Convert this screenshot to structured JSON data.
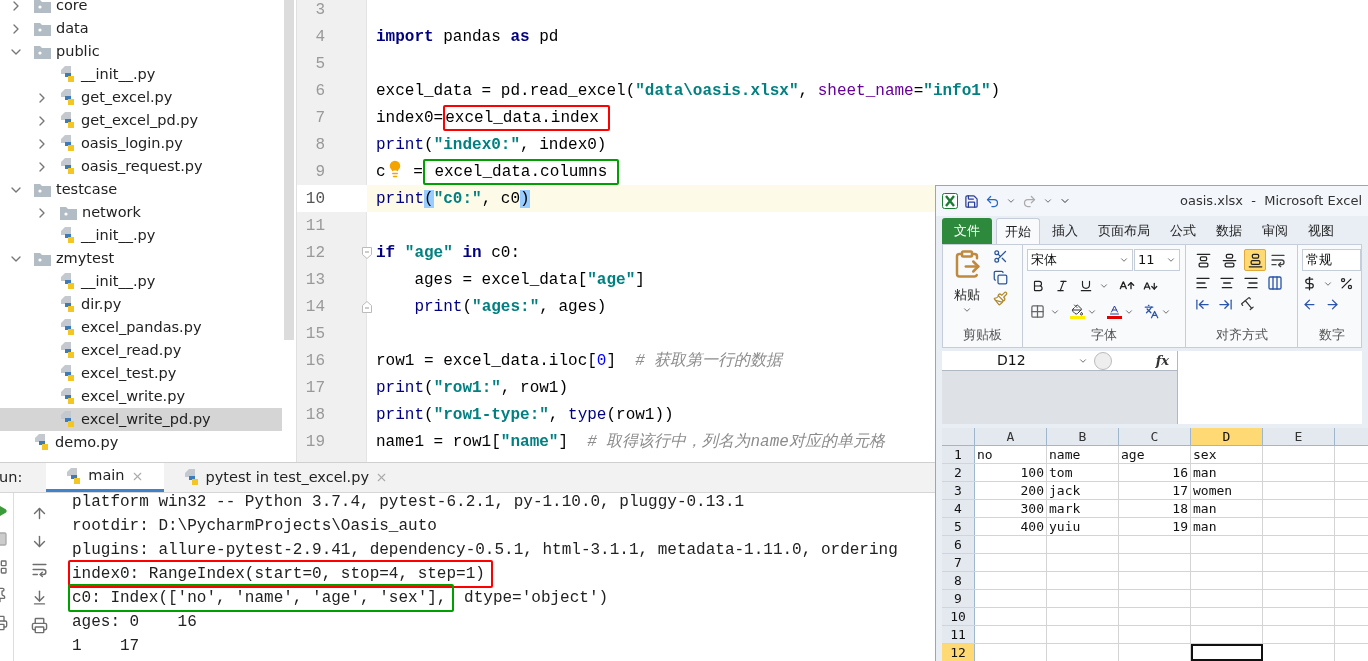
{
  "project_tree": {
    "items": [
      {
        "label": "core",
        "kind": "folder",
        "expanded": false,
        "selected": false
      },
      {
        "label": "data",
        "kind": "folder",
        "expanded": false,
        "selected": false
      },
      {
        "label": "public",
        "kind": "folder",
        "expanded": true,
        "selected": false,
        "children": [
          {
            "label": "__init__.py",
            "kind": "file",
            "selected": false
          },
          {
            "label": "get_excel.py",
            "kind": "file",
            "expanded": false,
            "selected": false
          },
          {
            "label": "get_excel_pd.py",
            "kind": "file",
            "expanded": false,
            "selected": false
          },
          {
            "label": "oasis_login.py",
            "kind": "file",
            "expanded": false,
            "selected": false
          },
          {
            "label": "oasis_request.py",
            "kind": "file",
            "expanded": false,
            "selected": false
          }
        ]
      },
      {
        "label": "testcase",
        "kind": "folder",
        "expanded": true,
        "selected": false,
        "children": [
          {
            "label": "network",
            "kind": "folder",
            "expanded": false,
            "selected": false
          },
          {
            "label": "__init__.py",
            "kind": "file",
            "selected": false
          }
        ]
      },
      {
        "label": "zmytest",
        "kind": "folder",
        "expanded": true,
        "selected": false,
        "children": [
          {
            "label": "__init__.py",
            "kind": "file",
            "selected": false
          },
          {
            "label": "dir.py",
            "kind": "file",
            "selected": false
          },
          {
            "label": "excel_pandas.py",
            "kind": "file",
            "selected": false
          },
          {
            "label": "excel_read.py",
            "kind": "file",
            "selected": false
          },
          {
            "label": "excel_test.py",
            "kind": "file",
            "selected": false
          },
          {
            "label": "excel_write.py",
            "kind": "file",
            "selected": false
          },
          {
            "label": "excel_write_pd.py",
            "kind": "file",
            "selected": true
          }
        ]
      },
      {
        "label": "demo.py",
        "kind": "file",
        "selected": false
      }
    ]
  },
  "editor": {
    "lines": [
      {
        "number": "3",
        "current": false
      },
      {
        "number": "4",
        "current": false,
        "tokens": [
          {
            "text": "import",
            "kind": "keyword"
          },
          {
            "text": " pandas ",
            "kind": "plain"
          },
          {
            "text": "as",
            "kind": "keyword"
          },
          {
            "text": " pd",
            "kind": "plain"
          }
        ]
      },
      {
        "number": "5",
        "current": false
      },
      {
        "number": "6",
        "current": false,
        "tokens": [
          {
            "text": "excel_data = pd.read_excel(",
            "kind": "plain"
          },
          {
            "text": "\"data\\oasis.xlsx\"",
            "kind": "string"
          },
          {
            "text": ", ",
            "kind": "plain"
          },
          {
            "text": "sheet_name",
            "kind": "param"
          },
          {
            "text": "=",
            "kind": "plain"
          },
          {
            "text": "\"info1\"",
            "kind": "string"
          },
          {
            "text": ")",
            "kind": "plain"
          }
        ]
      },
      {
        "number": "7",
        "current": false,
        "tokens": [
          {
            "text": "index0=",
            "kind": "plain"
          },
          {
            "text": "excel_data.index ",
            "kind": "plain",
            "box": {
              "color": "#ff0000"
            }
          }
        ]
      },
      {
        "number": "8",
        "current": false,
        "tokens": [
          {
            "text": "print",
            "kind": "builtin"
          },
          {
            "text": "(",
            "kind": "plain"
          },
          {
            "text": "\"index0:\"",
            "kind": "string"
          },
          {
            "text": ", index0)",
            "kind": "plain"
          }
        ]
      },
      {
        "number": "9",
        "current": false,
        "tokens": [
          {
            "text": "c",
            "kind": "plain"
          },
          {
            "kind": "bulb"
          },
          {
            "text": " =",
            "kind": "plain"
          },
          {
            "text": " excel_data.columns ",
            "kind": "plain",
            "box": {
              "color": "#00a000"
            }
          }
        ]
      },
      {
        "number": "10",
        "current": true,
        "tokens": [
          {
            "text": "print",
            "kind": "builtin"
          },
          {
            "text": "(",
            "kind": "brace_match"
          },
          {
            "text": "\"c0:\"",
            "kind": "string"
          },
          {
            "text": ", c0",
            "kind": "plain"
          },
          {
            "text": ")",
            "kind": "brace_match"
          }
        ]
      },
      {
        "number": "11",
        "current": false
      },
      {
        "number": "12",
        "current": false,
        "fold_marker": {
          "kind": "start"
        },
        "tokens": [
          {
            "text": "if ",
            "kind": "keyword"
          },
          {
            "text": "\"age\" ",
            "kind": "string"
          },
          {
            "text": "in",
            "kind": "keyword"
          },
          {
            "text": " c0:",
            "kind": "plain"
          }
        ]
      },
      {
        "number": "13",
        "current": false,
        "tokens": [
          {
            "text": "    ages = excel_data[",
            "kind": "plain"
          },
          {
            "text": "\"age\"",
            "kind": "string"
          },
          {
            "text": "]",
            "kind": "plain"
          }
        ]
      },
      {
        "number": "14",
        "current": false,
        "fold_marker": {
          "kind": "end"
        },
        "tokens": [
          {
            "text": "    print",
            "kind": "builtin"
          },
          {
            "text": "(",
            "kind": "plain"
          },
          {
            "text": "\"ages:\"",
            "kind": "string"
          },
          {
            "text": ", ages)",
            "kind": "plain"
          }
        ]
      },
      {
        "number": "15",
        "current": false
      },
      {
        "number": "16",
        "current": false,
        "tokens": [
          {
            "text": "row1 = excel_data.iloc[",
            "kind": "plain"
          },
          {
            "text": "0",
            "kind": "number"
          },
          {
            "text": "]  ",
            "kind": "plain"
          },
          {
            "text": "# 获取第一行的数据",
            "kind": "comment"
          }
        ]
      },
      {
        "number": "17",
        "current": false,
        "tokens": [
          {
            "text": "print",
            "kind": "builtin"
          },
          {
            "text": "(",
            "kind": "plain"
          },
          {
            "text": "\"row1:\"",
            "kind": "string"
          },
          {
            "text": ", row1)",
            "kind": "plain"
          }
        ]
      },
      {
        "number": "18",
        "current": false,
        "tokens": [
          {
            "text": "print",
            "kind": "builtin"
          },
          {
            "text": "(",
            "kind": "plain"
          },
          {
            "text": "\"row1-type:\"",
            "kind": "string"
          },
          {
            "text": ", ",
            "kind": "plain"
          },
          {
            "text": "type",
            "kind": "builtin"
          },
          {
            "text": "(row1))",
            "kind": "plain"
          }
        ]
      },
      {
        "number": "19",
        "current": false,
        "tokens": [
          {
            "text": "name1 = row1[",
            "kind": "plain"
          },
          {
            "text": "\"name\"",
            "kind": "string"
          },
          {
            "text": "]  ",
            "kind": "plain"
          },
          {
            "text": "# 取得该行中，列名为name对应的单元格",
            "kind": "comment"
          }
        ]
      }
    ]
  },
  "run_panel": {
    "label": "un:",
    "tabs": [
      {
        "label": "main",
        "selected": true
      },
      {
        "label": "pytest in test_excel.py",
        "selected": false
      }
    ],
    "output": [
      [
        {
          "text": "platform win32 -- Python 3.7.4, pytest-6.2.1, py-1.10.0, pluggy-0.13.1"
        }
      ],
      [
        {
          "text": "rootdir: D:\\PycharmProjects\\Oasis_auto"
        }
      ],
      [
        {
          "text": "plugins: allure-pytest-2.9.41, dependency-0.5.1, html-3.1.1, metadata-1.11.0, ordering"
        }
      ],
      [
        {
          "text": "index0: RangeIndex(start=0, stop=4, step=1)",
          "box": {
            "color": "#ff0000"
          }
        }
      ],
      [
        {
          "text": "c0: Index(['no', 'name', 'age', 'sex'],",
          "box": {
            "color": "#00a000"
          }
        },
        {
          "text": " dtype='object')"
        }
      ],
      [
        {
          "text": "ages: 0    16"
        }
      ],
      [
        {
          "text": "1    17"
        }
      ]
    ]
  },
  "excel": {
    "title": "oasis.xlsx  -  Microsoft Excel",
    "tabs": [
      {
        "label": "文件",
        "kind": "file",
        "selected": false
      },
      {
        "label": "开始",
        "kind": "tab",
        "selected": true
      },
      {
        "label": "插入",
        "kind": "tab",
        "selected": false
      },
      {
        "label": "页面布局",
        "kind": "tab",
        "selected": false
      },
      {
        "label": "公式",
        "kind": "tab",
        "selected": false
      },
      {
        "label": "数据",
        "kind": "tab",
        "selected": false
      },
      {
        "label": "审阅",
        "kind": "tab",
        "selected": false
      },
      {
        "label": "视图",
        "kind": "tab",
        "selected": false
      }
    ],
    "ribbon": {
      "paste_label": "粘贴",
      "font_name": "宋体",
      "font_size": "11",
      "number_format": "常规",
      "vertical_align": [
        {
          "kind": "top",
          "selected": false
        },
        {
          "kind": "middle",
          "selected": false
        },
        {
          "kind": "bottom",
          "selected": true
        }
      ],
      "groups": [
        "剪贴板",
        "字体",
        "对齐方式",
        "数字"
      ]
    },
    "name_box": "D12",
    "formula_label": "fx",
    "columns": [
      {
        "label": "A",
        "selected": false
      },
      {
        "label": "B",
        "selected": false
      },
      {
        "label": "C",
        "selected": false
      },
      {
        "label": "D",
        "selected": true
      },
      {
        "label": "E",
        "selected": false
      }
    ],
    "rows": [
      {
        "number": "1",
        "selected": false,
        "cells": [
          {
            "text": "no",
            "kind": "text"
          },
          {
            "text": "name",
            "kind": "text"
          },
          {
            "text": "age",
            "kind": "text"
          },
          {
            "text": "sex",
            "kind": "text"
          }
        ]
      },
      {
        "number": "2",
        "selected": false,
        "cells": [
          {
            "text": "100",
            "kind": "number"
          },
          {
            "text": "tom",
            "kind": "text"
          },
          {
            "text": "16",
            "kind": "number"
          },
          {
            "text": "man",
            "kind": "text"
          }
        ]
      },
      {
        "number": "3",
        "selected": false,
        "cells": [
          {
            "text": "200",
            "kind": "number"
          },
          {
            "text": "jack",
            "kind": "text"
          },
          {
            "text": "17",
            "kind": "number"
          },
          {
            "text": "women",
            "kind": "text"
          }
        ]
      },
      {
        "number": "4",
        "selected": false,
        "cells": [
          {
            "text": "300",
            "kind": "number"
          },
          {
            "text": "mark",
            "kind": "text"
          },
          {
            "text": "18",
            "kind": "number"
          },
          {
            "text": "man",
            "kind": "text"
          }
        ]
      },
      {
        "number": "5",
        "selected": false,
        "cells": [
          {
            "text": "400",
            "kind": "number"
          },
          {
            "text": "yuiu",
            "kind": "text"
          },
          {
            "text": "19",
            "kind": "number"
          },
          {
            "text": "man",
            "kind": "text"
          }
        ]
      },
      {
        "number": "6",
        "selected": false
      },
      {
        "number": "7",
        "selected": false
      },
      {
        "number": "8",
        "selected": false
      },
      {
        "number": "9",
        "selected": false
      },
      {
        "number": "10",
        "selected": false
      },
      {
        "number": "11",
        "selected": false
      },
      {
        "number": "12",
        "selected": true
      }
    ]
  }
}
